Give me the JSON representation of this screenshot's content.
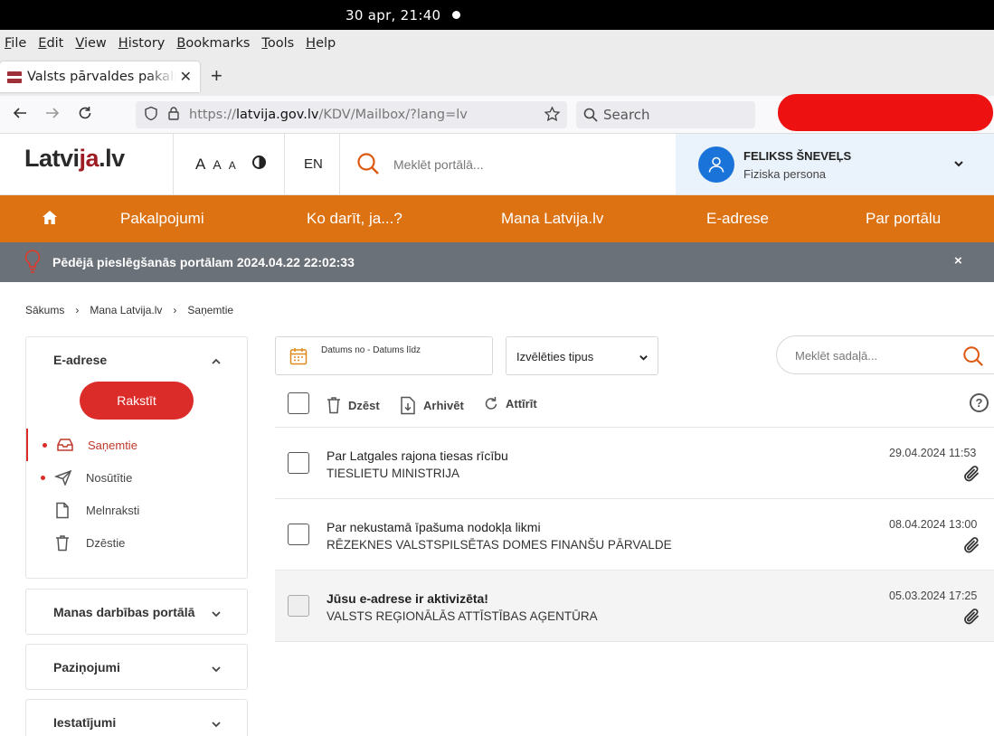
{
  "os": {
    "clock": "30  apr, 21:40"
  },
  "browser": {
    "menu": [
      "File",
      "Edit",
      "View",
      "History",
      "Bookmarks",
      "Tools",
      "Help"
    ],
    "tab_title": "Valsts pārvaldes pakalpojumu portāls",
    "url_prefix": "https://",
    "url_host": "latvija.gov.lv",
    "url_path": "/KDV/Mailbox/?lang=lv",
    "search_placeholder": "Search"
  },
  "header": {
    "logo_a": "Latvi",
    "logo_b": "ja",
    "logo_c": ".lv",
    "font_sizes": [
      "A",
      "A",
      "A"
    ],
    "lang": "EN",
    "search_placeholder": "Meklēt portālā...",
    "user_name": "FELIKSS ŠNEVEĻS",
    "user_type": "Fiziska persona"
  },
  "nav": [
    "Pakalpojumi",
    "Ko darīt, ja...?",
    "Mana Latvija.lv",
    "E-adrese",
    "Par portālu"
  ],
  "notice": {
    "text": "Pēdējā pieslēgšanās portālam 2024.04.22 22:02:33",
    "close": "×"
  },
  "breadcrumb": [
    "Sākums",
    "Mana Latvija.lv",
    "Saņemtie"
  ],
  "sidebar": {
    "eaddress_title": "E-adrese",
    "write_label": "Rakstīt",
    "items": [
      {
        "label": "Saņemtie",
        "dot": true,
        "active": true,
        "icon": "inbox-icon"
      },
      {
        "label": "Nosūtītie",
        "dot": true,
        "active": false,
        "icon": "send-icon"
      },
      {
        "label": "Melnraksti",
        "dot": false,
        "active": false,
        "icon": "draft-icon"
      },
      {
        "label": "Dzēstie",
        "dot": false,
        "active": false,
        "icon": "trash-icon"
      }
    ],
    "sections": [
      "Manas darbības portālā",
      "Paziņojumi",
      "Iestatījumi"
    ]
  },
  "filters": {
    "date_range": "Datums no - Datums līdz",
    "type_select": "Izvēlēties tipus",
    "section_search_placeholder": "Meklēt sadaļā..."
  },
  "actions": {
    "delete": "Dzēst",
    "archive": "Arhivēt",
    "restore": "Attīrīt",
    "help": "?"
  },
  "messages": [
    {
      "subject": "Par Latgales rajona tiesas rīcību",
      "sender": "TIESLIETU MINISTRIJA",
      "date": "29.04.2024 11:53",
      "read": false,
      "attachment": true
    },
    {
      "subject": "Par nekustamā īpašuma nodokļa likmi",
      "sender": "RĒZEKNES VALSTSPILSĒTAS DOMES FINANŠU PĀRVALDE",
      "date": "08.04.2024 13:00",
      "read": false,
      "attachment": true
    },
    {
      "subject": "Jūsu e-adrese ir aktivizēta!",
      "sender": "VALSTS REĢIONĀLĀS ATTĪSTĪBAS AĢENTŪRA",
      "date": "05.03.2024 17:25",
      "read": true,
      "attachment": true
    }
  ],
  "colors": {
    "nav_orange": "#dd7212",
    "accent_red": "#dc2c29",
    "notice_gray": "#6b7178",
    "user_blue": "#1a73d9"
  }
}
